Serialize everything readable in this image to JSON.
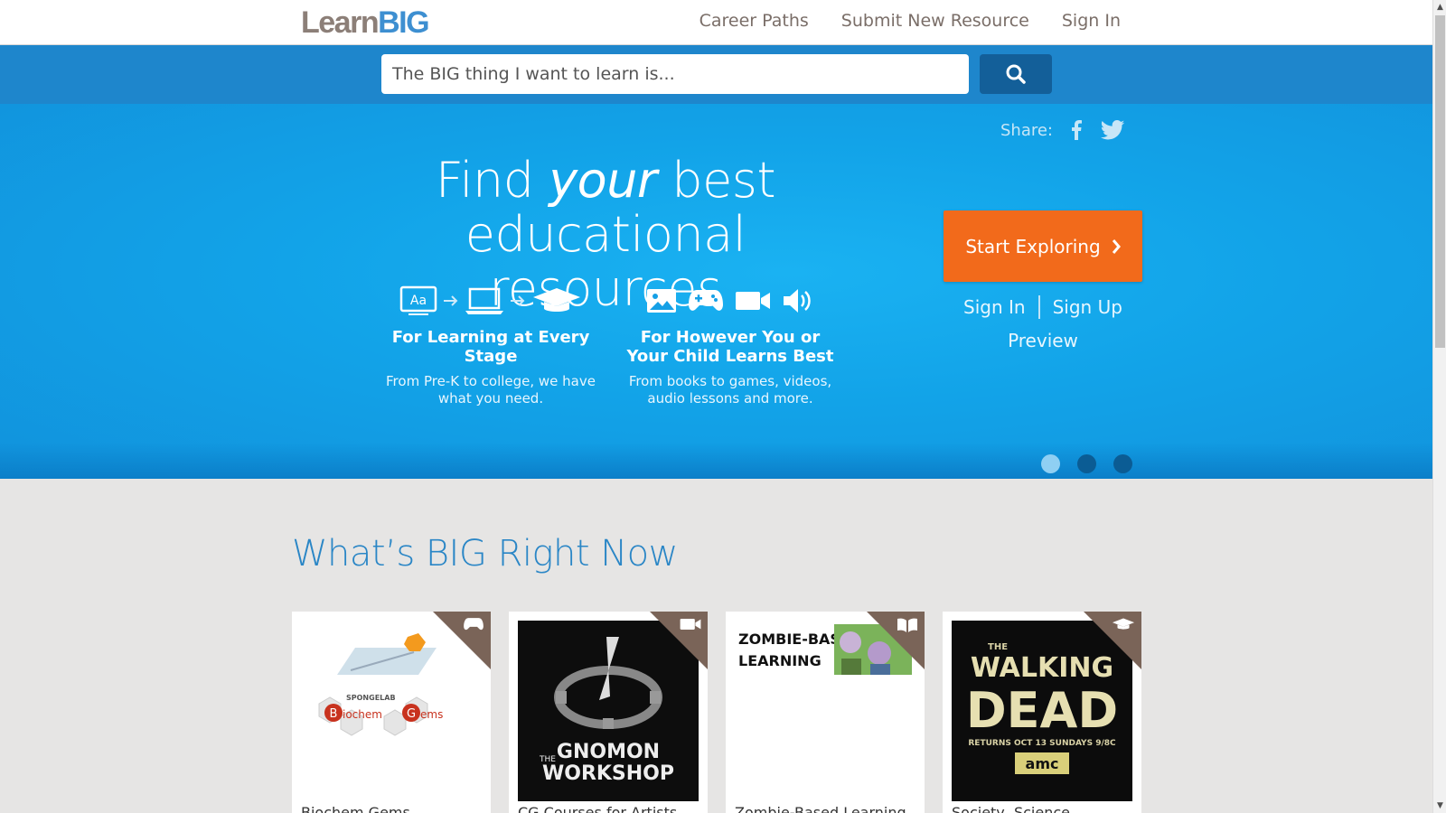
{
  "brand": {
    "learn": "Learn",
    "big": "BIG"
  },
  "nav": {
    "career_paths": "Career Paths",
    "submit": "Submit New Resource",
    "sign_in": "Sign In"
  },
  "search": {
    "placeholder": "The BIG thing I want to learn is..."
  },
  "hero": {
    "share_label": "Share:",
    "title_pre": "Find ",
    "title_em": "your",
    "title_post": " best",
    "title_line2": "educational resources",
    "feature1": {
      "title": "For Learning at Every Stage",
      "desc": "From Pre-K to college, we have what you need."
    },
    "feature2": {
      "title": "For However You or Your Child Learns Best",
      "desc": "From books to games, videos, audio lessons and more."
    },
    "cta": "Start Exploring",
    "sign_in": "Sign In",
    "sign_up": "Sign Up",
    "preview": "Preview",
    "carousel_active": 1,
    "carousel_count": 3
  },
  "section": {
    "title": "What’s BIG Right Now"
  },
  "cards": [
    {
      "title": "Biochem Gems",
      "type_icon": "gamepad-icon",
      "thumb_text": "Biochem Gems"
    },
    {
      "title": "CG Courses for Artists",
      "type_icon": "video-icon",
      "thumb_text": "THE GNOMON WORKSHOP"
    },
    {
      "title": "Zombie-Based Learning",
      "type_icon": "book-icon",
      "thumb_text": "ZOMBIE-BASED LEARNING"
    },
    {
      "title": "Society, Science",
      "type_icon": "graduation-cap-icon",
      "thumb_text": "THE WALKING DEAD",
      "thumb_sub": "RETURNS OCT 13 SUNDAYS 9/8C",
      "thumb_badge": "amc"
    }
  ],
  "colors": {
    "accent": "#1e86cc",
    "cta": "#f26a1b",
    "corner": "#7a6458"
  }
}
